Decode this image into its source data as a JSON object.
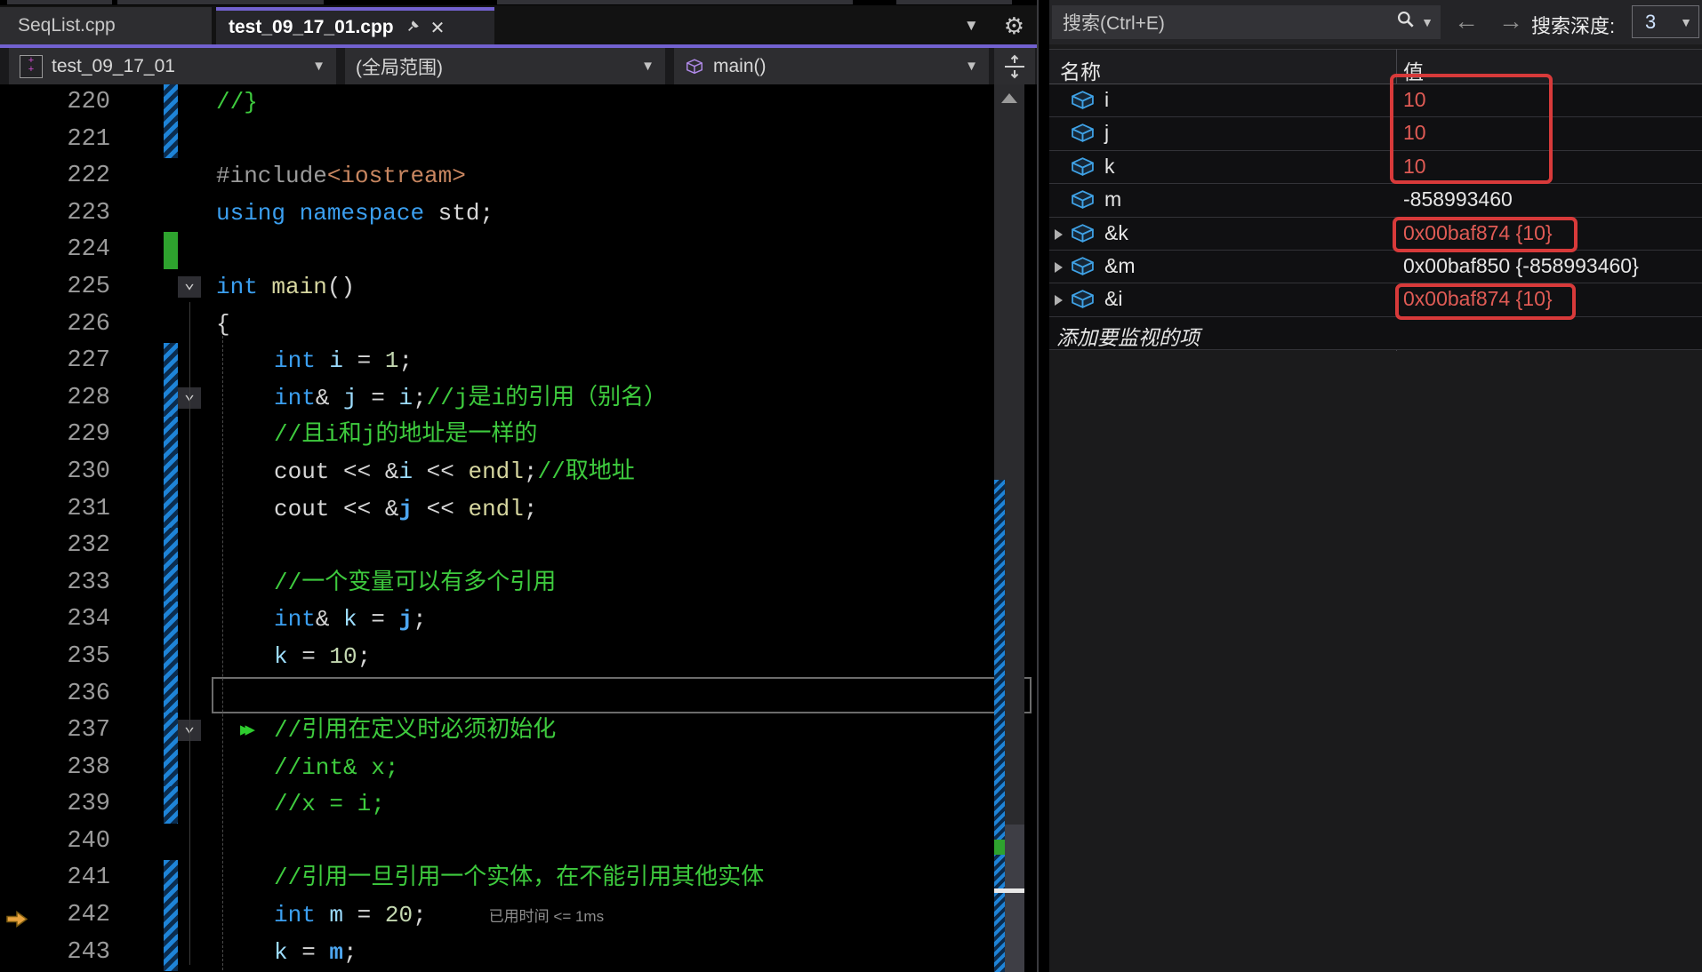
{
  "colors": {
    "accent_purple": "#7261cf",
    "changed_value_red": "#e05b55",
    "annotation_red": "#d83a3a",
    "comment_green": "#3ecb3e",
    "keyword_blue": "#3b9ff0",
    "exec_arrow_yellow": "#e8a33d",
    "change_bar_blue": "#1e84d8",
    "change_bar_green": "#2ea32e"
  },
  "tabs": {
    "inactive_label": "SeqList.cpp",
    "active_label": "test_09_17_01.cpp"
  },
  "nav": {
    "project": "test_09_17_01",
    "scope": "(全局范围)",
    "function": "main()"
  },
  "editor": {
    "perftip": "已用时间 <= 1ms",
    "lines": [
      {
        "num": "220",
        "indent": 0,
        "bar": "blue",
        "tokens": [
          [
            "cm",
            "//}"
          ]
        ]
      },
      {
        "num": "221",
        "indent": 0,
        "bar": "blue",
        "tokens": []
      },
      {
        "num": "222",
        "indent": 0,
        "tokens": [
          [
            "pp",
            "#include"
          ],
          [
            "str",
            "<iostream>"
          ]
        ]
      },
      {
        "num": "223",
        "indent": 0,
        "tokens": [
          [
            "kw",
            "using"
          ],
          [
            "pl",
            " "
          ],
          [
            "kw",
            "namespace"
          ],
          [
            "pl",
            " std;"
          ]
        ]
      },
      {
        "num": "224",
        "indent": 0,
        "bar": "green",
        "tokens": []
      },
      {
        "num": "225",
        "indent": 0,
        "fold": true,
        "tokens": [
          [
            "kw",
            "int"
          ],
          [
            "pl",
            " "
          ],
          [
            "fn",
            "main"
          ],
          [
            "pl",
            "()"
          ]
        ]
      },
      {
        "num": "226",
        "indent": 0,
        "tokens": [
          [
            "pl",
            "{"
          ]
        ]
      },
      {
        "num": "227",
        "indent": 1,
        "bar": "blue",
        "tokens": [
          [
            "kw",
            "int"
          ],
          [
            "pl",
            " "
          ],
          [
            "var",
            "i"
          ],
          [
            "pl",
            " = "
          ],
          [
            "num",
            "1"
          ],
          [
            "pl",
            ";"
          ]
        ]
      },
      {
        "num": "228",
        "indent": 1,
        "bar": "blue",
        "fold": true,
        "tokens": [
          [
            "kw",
            "int"
          ],
          [
            "pl",
            "& "
          ],
          [
            "var",
            "j"
          ],
          [
            "pl",
            " = "
          ],
          [
            "var",
            "i"
          ],
          [
            "pl",
            ";"
          ],
          [
            "cm",
            "//j是i的引用（别名）"
          ]
        ]
      },
      {
        "num": "229",
        "indent": 1,
        "bar": "blue",
        "tokens": [
          [
            "cm",
            "//且i和j的地址是一样的"
          ]
        ]
      },
      {
        "num": "230",
        "indent": 1,
        "bar": "blue",
        "tokens": [
          [
            "pl",
            "cout << &"
          ],
          [
            "var",
            "i"
          ],
          [
            "pl",
            " << "
          ],
          [
            "fn",
            "endl"
          ],
          [
            "pl",
            ";"
          ],
          [
            "cm",
            "//取地址"
          ]
        ]
      },
      {
        "num": "231",
        "indent": 1,
        "bar": "blue",
        "tokens": [
          [
            "pl",
            "cout << &"
          ],
          [
            "ref",
            "j"
          ],
          [
            "pl",
            " << "
          ],
          [
            "fn",
            "endl"
          ],
          [
            "pl",
            ";"
          ]
        ]
      },
      {
        "num": "232",
        "indent": 1,
        "bar": "blue",
        "tokens": []
      },
      {
        "num": "233",
        "indent": 1,
        "bar": "blue",
        "tokens": [
          [
            "cm",
            "//一个变量可以有多个引用"
          ]
        ]
      },
      {
        "num": "234",
        "indent": 1,
        "bar": "blue",
        "tokens": [
          [
            "kw",
            "int"
          ],
          [
            "pl",
            "& "
          ],
          [
            "var",
            "k"
          ],
          [
            "pl",
            " = "
          ],
          [
            "ref",
            "j"
          ],
          [
            "pl",
            ";"
          ]
        ]
      },
      {
        "num": "235",
        "indent": 1,
        "bar": "blue",
        "tokens": [
          [
            "var",
            "k"
          ],
          [
            "pl",
            " = "
          ],
          [
            "num",
            "10"
          ],
          [
            "pl",
            ";"
          ]
        ]
      },
      {
        "num": "236",
        "indent": 1,
        "bar": "blue",
        "boxed": true,
        "tokens": []
      },
      {
        "num": "237",
        "indent": 1,
        "bar": "blue",
        "fold": true,
        "runto": true,
        "tokens": [
          [
            "cm",
            "//引用在定义时必须初始化"
          ]
        ]
      },
      {
        "num": "238",
        "indent": 1,
        "bar": "blue",
        "tokens": [
          [
            "cm",
            "//int& x;"
          ]
        ]
      },
      {
        "num": "239",
        "indent": 1,
        "bar": "blue",
        "tokens": [
          [
            "cm",
            "//x = i;"
          ]
        ]
      },
      {
        "num": "240",
        "indent": 1,
        "tokens": []
      },
      {
        "num": "241",
        "indent": 1,
        "bar": "blue",
        "tokens": [
          [
            "cm",
            "//引用一旦引用一个实体，在不能引用其他实体"
          ]
        ]
      },
      {
        "num": "242",
        "indent": 1,
        "bar": "blue",
        "arrow": true,
        "perftip": true,
        "tokens": [
          [
            "kw",
            "int"
          ],
          [
            "pl",
            " "
          ],
          [
            "var",
            "m"
          ],
          [
            "pl",
            " = "
          ],
          [
            "num",
            "20"
          ],
          [
            "pl",
            ";"
          ]
        ]
      },
      {
        "num": "243",
        "indent": 1,
        "bar": "blue",
        "tokens": [
          [
            "var",
            "k"
          ],
          [
            "pl",
            " = "
          ],
          [
            "ref",
            "m"
          ],
          [
            "pl",
            ";"
          ]
        ]
      }
    ]
  },
  "watch": {
    "search_placeholder": "搜索(Ctrl+E)",
    "depth_label": "搜索深度:",
    "depth_value": "3",
    "columns": {
      "name": "名称",
      "value": "值"
    },
    "rows": [
      {
        "name": "i",
        "value": "10",
        "changed": true,
        "expandable": false
      },
      {
        "name": "j",
        "value": "10",
        "changed": true,
        "expandable": false
      },
      {
        "name": "k",
        "value": "10",
        "changed": true,
        "expandable": false
      },
      {
        "name": "m",
        "value": "-858993460",
        "changed": false,
        "expandable": false
      },
      {
        "name": "&k",
        "value": "0x00baf874 {10}",
        "changed": true,
        "expandable": true
      },
      {
        "name": "&m",
        "value": "0x00baf850 {-858993460}",
        "changed": false,
        "expandable": true
      },
      {
        "name": "&i",
        "value": "0x00baf874 {10}",
        "changed": true,
        "expandable": true
      }
    ],
    "add_row_label": "添加要监视的项"
  }
}
